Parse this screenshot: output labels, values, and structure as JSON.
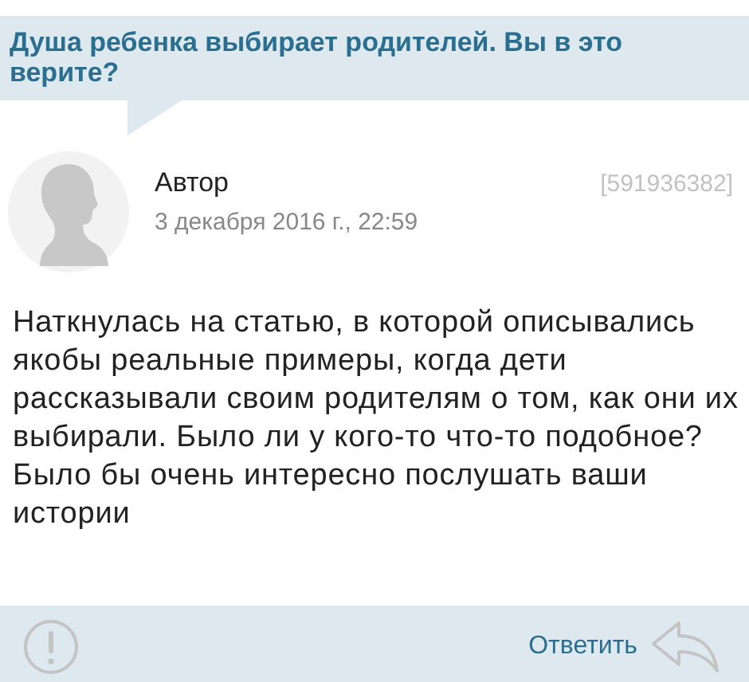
{
  "topic": {
    "title": "Душа ребенка выбирает родителей. Вы в это верите?"
  },
  "post": {
    "author": "Автор",
    "date": "3 декабря 2016 г., 22:59",
    "post_id": "[591936382]",
    "text": "Наткнулась на статью, в которой описывались якобы реальные примеры, когда дети рассказывали своим родителям о том, как они их выбирали. Было ли у кого-то что-то подобное? Было бы очень интересно послушать ваши истории"
  },
  "footer": {
    "reply_label": "Ответить"
  }
}
